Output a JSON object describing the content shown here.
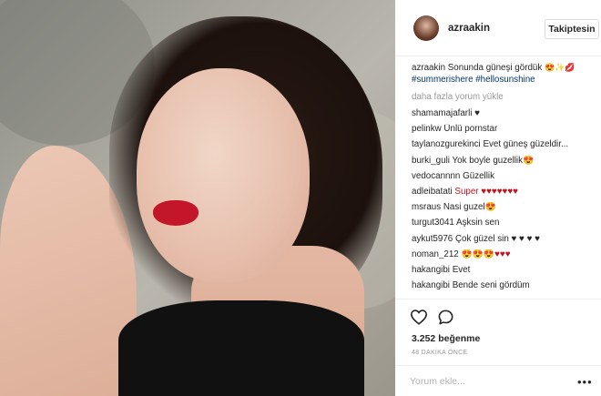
{
  "post": {
    "username": "azraakin",
    "follow_label": "Takiptesin",
    "caption": {
      "username": "azraakin",
      "text": "Sonunda güneşi gördük",
      "emoji": "😍✨💋",
      "tags": "#summerishere #hellosunshine"
    },
    "load_more": "daha fazla yorum yükle",
    "comments": [
      {
        "user": "shamamajafarli",
        "text": "♥"
      },
      {
        "user": "pelinkw",
        "text": "Ünlü pornstar"
      },
      {
        "user": "taylanozgurekinci",
        "text": "Evet güneş güzeldir..."
      },
      {
        "user": "burki_guli",
        "text": "Yok boyle guzellik😍"
      },
      {
        "user": "vedocannnn",
        "text": "Güzellik"
      },
      {
        "user": "adleibatati",
        "text": "Super ♥♥♥♥♥♥♥"
      },
      {
        "user": "msraus",
        "text": "Nasi guzel😍"
      },
      {
        "user": "turgut3041",
        "text": "Aşksin sen"
      },
      {
        "user": "aykut5976",
        "text": "Çok güzel sin ♥ ♥ ♥ ♥"
      },
      {
        "user": "noman_212",
        "text": "😍😍😍♥♥♥"
      },
      {
        "user": "hakangibi",
        "text": "Evet"
      },
      {
        "user": "hakangibi",
        "text": "Bende seni gördüm"
      }
    ],
    "likes": "3.252 beğenme",
    "time_ago": "48 DAKİKA ÖNCE",
    "comment_placeholder": "Yorum ekle...",
    "more_options": "•••",
    "colors": {
      "accent_tag": "#003569",
      "heart_red": "#c0141f"
    },
    "icons": {
      "like": "heart-outline-icon",
      "comment": "speech-bubble-icon"
    }
  }
}
